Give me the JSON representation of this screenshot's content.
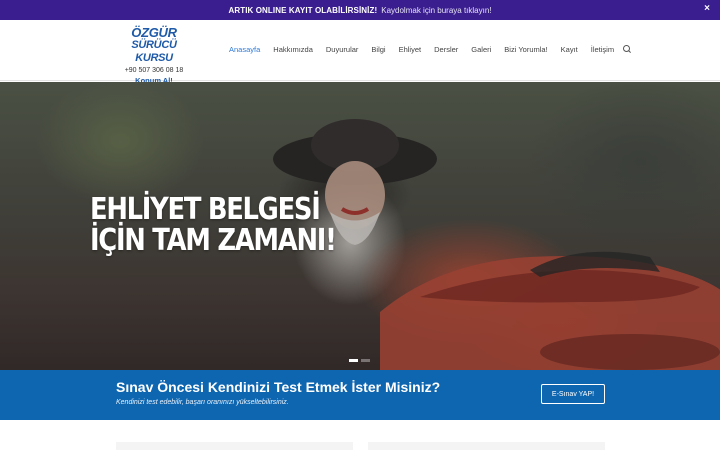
{
  "announcement": {
    "bold_text": "ARTIK ONLINE KAYIT OLABİLİRSİNİZ!",
    "link_text": "Kaydolmak için buraya tıklayın!",
    "close_label": "×"
  },
  "brand": {
    "line1": "ÖZGÜR",
    "line2": "SÜRÜCÜ KURSU",
    "phone": "+90 507 306 08 18",
    "location_label": "Konum Al!",
    "color": "#1e5aa8"
  },
  "nav": {
    "items": [
      {
        "label": "Anasayfa",
        "active": true
      },
      {
        "label": "Hakkımızda"
      },
      {
        "label": "Duyurular"
      },
      {
        "label": "Bilgi"
      },
      {
        "label": "Ehliyet"
      },
      {
        "label": "Dersler"
      },
      {
        "label": "Galeri"
      },
      {
        "label": "Bizi Yorumla!"
      },
      {
        "label": "Kayıt"
      },
      {
        "label": "İletişim"
      }
    ],
    "search_icon": "search-icon",
    "active_color": "#2e7bd6"
  },
  "hero": {
    "headline_line1": "EHLİYET BELGESİ",
    "headline_line2": "İÇİN TAM ZAMANI!",
    "slide_count": 2,
    "active_slide": 1
  },
  "test_banner": {
    "title": "Sınav Öncesi Kendinizi Test Etmek İster Misiniz?",
    "subtitle": "Kendinizi test edebilir, başarı oranınızı yükseltebilirsiniz.",
    "button_label": "E-Sınav YAP!",
    "background": "#0f66b0"
  },
  "colors": {
    "topbar": "#3a1e8f"
  }
}
